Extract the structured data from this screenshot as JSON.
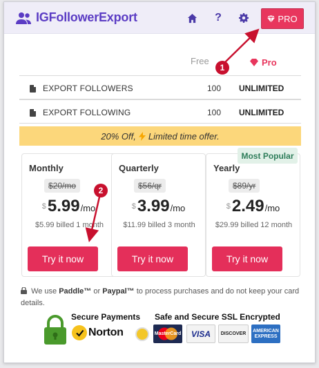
{
  "header": {
    "app_name": "IGFollowerExport",
    "help_label": "?",
    "pro_label": "PRO"
  },
  "plans_header": {
    "free_label": "Free",
    "pro_label": "Pro"
  },
  "features": [
    {
      "name": "EXPORT FOLLOWERS",
      "free": "100",
      "pro": "UNLIMITED"
    },
    {
      "name": "EXPORT FOLLOWING",
      "free": "100",
      "pro": "UNLIMITED"
    }
  ],
  "promo": {
    "text_before": "20% Off,",
    "text_after": "Limited time offer."
  },
  "pricing": [
    {
      "title": "Monthly",
      "original": "$20/mo",
      "currency": "$",
      "amount": "5.99",
      "period": "/mo",
      "billed": "$5.99 billed 1 month",
      "button": "Try it now"
    },
    {
      "title": "Quarterly",
      "original": "$56/qr",
      "currency": "$",
      "amount": "3.99",
      "period": "/mo",
      "billed": "$11.99 billed 3 month",
      "button": "Try it now"
    },
    {
      "title": "Yearly",
      "original": "$89/yr",
      "currency": "$",
      "amount": "2.49",
      "period": "/mo",
      "billed": "$29.99 billed 12 month",
      "button": "Try it now"
    }
  ],
  "most_popular": "Most Popular",
  "note": {
    "prefix": "We use",
    "paddle": "Paddle™",
    "or": "or",
    "paypal": "Paypal™",
    "suffix": "to process purchases and do not keep your card details."
  },
  "trust": {
    "secure_title": "Secure Payments",
    "norton": "Norton",
    "ssl_title": "Safe and Secure SSL Encrypted",
    "mastercard": "MasterCard",
    "visa": "VISA",
    "discover": "DISCOVER",
    "amex": "AMERICAN EXPRESS"
  },
  "annotations": [
    "1",
    "2"
  ],
  "colors": {
    "brand": "#5b3cc4",
    "accent": "#e8365d",
    "promo_bg": "#fcd77b",
    "annotation": "#c8102e"
  },
  "icons": {
    "logo": "users-icon",
    "home": "home-icon",
    "help": "question-icon",
    "settings": "gear-icon",
    "pro": "diamond-icon",
    "lightning": "lightning-icon",
    "lock": "lock-icon"
  }
}
